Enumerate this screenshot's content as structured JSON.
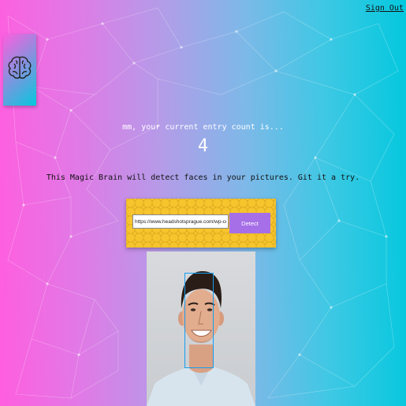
{
  "nav": {
    "signout_label": "Sign Out"
  },
  "logo": {
    "icon": "brain-icon",
    "colors": [
      "#ff5edf",
      "#04c8de"
    ]
  },
  "rank": {
    "greeting": "mm, your current entry count is...",
    "count": "4"
  },
  "intro": {
    "text": "This Magic Brain will detect faces in your pictures. Git it a try."
  },
  "form": {
    "url_value": "https://www.headshotsprague.com/wp-content/u",
    "detect_label": "Detect",
    "panel_color": "#f6c42c",
    "button_color": "#a66fe8"
  },
  "result": {
    "face_box_color": "#149df2",
    "faces_detected": 1
  },
  "background": {
    "colors": [
      "#ff5edf",
      "#04c8de"
    ]
  }
}
